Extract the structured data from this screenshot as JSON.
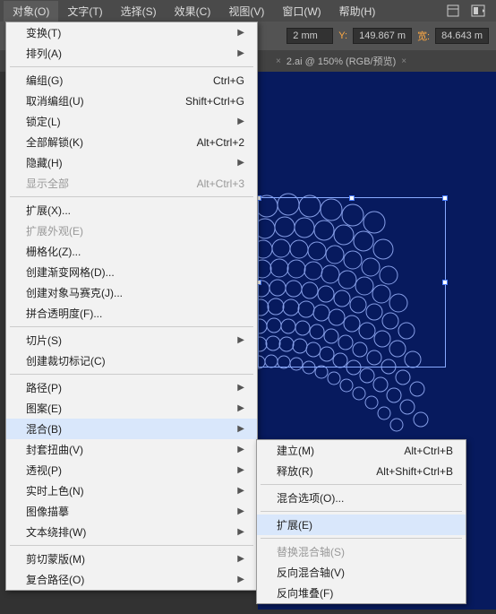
{
  "menubar": {
    "items": [
      "对象(O)",
      "文字(T)",
      "选择(S)",
      "效果(C)",
      "视图(V)",
      "窗口(W)",
      "帮助(H)"
    ]
  },
  "toolbar": {
    "unit1": "2 mm",
    "y_label": "Y:",
    "y_value": "149.867 m",
    "w_label": "宽:",
    "w_value": "84.643 m"
  },
  "tab": {
    "close1": "×",
    "label": "2.ai @ 150% (RGB/预览)",
    "close2": "×"
  },
  "menu": {
    "transform": "变换(T)",
    "arrange": "排列(A)",
    "group": "编组(G)",
    "group_sc": "Ctrl+G",
    "ungroup": "取消编组(U)",
    "ungroup_sc": "Shift+Ctrl+G",
    "lock": "锁定(L)",
    "unlock_all": "全部解锁(K)",
    "unlock_all_sc": "Alt+Ctrl+2",
    "hide": "隐藏(H)",
    "show_all": "显示全部",
    "show_all_sc": "Alt+Ctrl+3",
    "expand": "扩展(X)...",
    "expand_appearance": "扩展外观(E)",
    "rasterize": "栅格化(Z)...",
    "gradient_mesh": "创建渐变网格(D)...",
    "mosaic": "创建对象马赛克(J)...",
    "flatten": "拼合透明度(F)...",
    "slice": "切片(S)",
    "trim_marks": "创建裁切标记(C)",
    "path": "路径(P)",
    "pattern": "图案(E)",
    "blend": "混合(B)",
    "envelope": "封套扭曲(V)",
    "perspective": "透视(P)",
    "live_paint": "实时上色(N)",
    "image_trace": "图像描摹",
    "text_wrap": "文本绕排(W)",
    "clipping_mask": "剪切蒙版(M)",
    "compound_path": "复合路径(O)"
  },
  "submenu": {
    "make": "建立(M)",
    "make_sc": "Alt+Ctrl+B",
    "release": "释放(R)",
    "release_sc": "Alt+Shift+Ctrl+B",
    "options": "混合选项(O)...",
    "expand": "扩展(E)",
    "replace_spine": "替换混合轴(S)",
    "reverse_spine": "反向混合轴(V)",
    "reverse_front": "反向堆叠(F)"
  }
}
